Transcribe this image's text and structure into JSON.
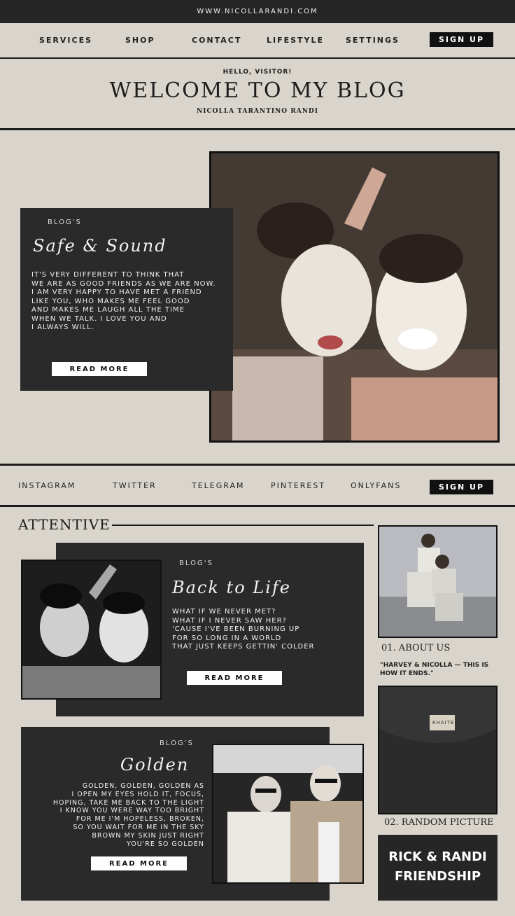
{
  "site_url": "WWW.NICOLLARANDI.COM",
  "nav": {
    "items": [
      "SERVICES",
      "SHOP",
      "CONTACT",
      "LIFESTYLE",
      "SETTINGS"
    ],
    "signup": "SIGN UP"
  },
  "header": {
    "greeting": "HELLO, VISITOR!",
    "title": "WELCOME TO MY BLOG",
    "author": "NICOLLA TARANTINO RANDI"
  },
  "posts": [
    {
      "kicker": "BLOG'S",
      "title": "Safe & Sound",
      "body": [
        "IT'S VERY DIFFERENT TO THINK THAT",
        "WE ARE AS GOOD FRIENDS AS WE ARE NOW.",
        "I AM VERY HAPPY TO HAVE MET A FRIEND",
        "LIKE YOU, WHO MAKES ME FEEL GOOD",
        "AND MAKES ME LAUGH ALL THE TIME",
        "WHEN WE TALK. I LOVE YOU AND",
        "I ALWAYS WILL."
      ],
      "button": "READ MORE"
    },
    {
      "kicker": "BLOG'S",
      "title": "Back to Life",
      "body": [
        "WHAT IF WE NEVER MET?",
        "WHAT IF I NEVER SAW HER?",
        "'CAUSE I'VE BEEN BURNING UP",
        "FOR SO LONG IN A WORLD",
        "THAT JUST KEEPS GETTIN' COLDER"
      ],
      "button": "READ MORE"
    },
    {
      "kicker": "BLOG'S",
      "title": "Golden",
      "body": [
        "GOLDEN, GOLDEN, GOLDEN AS",
        "I OPEN MY EYES HOLD IT, FOCUS,",
        "HOPING, TAKE ME BACK TO THE LIGHT",
        "I KNOW YOU WERE WAY TOO BRIGHT",
        "FOR ME I'M HOPELESS, BROKEN,",
        "SO YOU WAIT FOR ME IN THE SKY",
        "BROWN MY SKIN JUST RIGHT",
        "YOU'RE SO GOLDEN"
      ],
      "button": "READ MORE"
    }
  ],
  "social": {
    "items": [
      "INSTAGRAM",
      "TWITTER",
      "TELEGRAM",
      "PINTEREST",
      "ONLYFANS"
    ],
    "signup": "SIGN UP"
  },
  "section_title": "ATTENTIVE",
  "sidebar": {
    "about_caption": "01. ABOUT US",
    "quote": "\"HARVEY & NICOLLA — THIS IS HOW IT ENDS.\"",
    "random_caption": "02. RANDOM PICTURE",
    "sweater_label": "KHAITE",
    "badge_line1": "RICK & RANDI",
    "badge_line2": "FRIENDSHIP"
  },
  "colors": {
    "background": "#d9d5cc",
    "dark": "#2a2a2a",
    "ink": "#1c1c1c",
    "light": "#ffffff"
  },
  "icons": [
    "photo-friends-face-masks",
    "photo-friends-bw",
    "photo-friends-car",
    "photo-friends-sitting",
    "photo-sweater"
  ]
}
